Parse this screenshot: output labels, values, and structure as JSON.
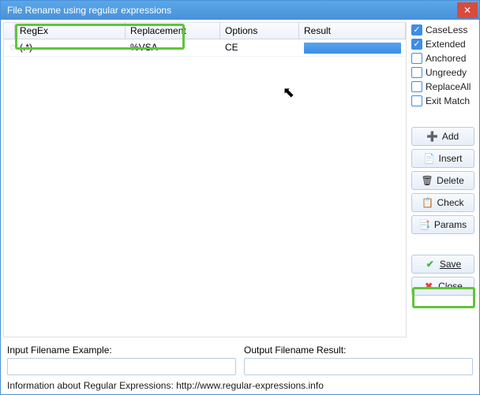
{
  "title": "File Rename using regular expressions",
  "grid": {
    "headers": {
      "regex": "RegEx",
      "replacement": "Replacement",
      "options": "Options",
      "result": "Result"
    },
    "rows": [
      {
        "regex": "(.*)",
        "replacement": "%VSA",
        "options": "CE"
      }
    ]
  },
  "checks": {
    "caseless": {
      "label": "CaseLess",
      "on": true
    },
    "extended": {
      "label": "Extended",
      "on": true
    },
    "anchored": {
      "label": "Anchored",
      "on": false
    },
    "ungreedy": {
      "label": "Ungreedy",
      "on": false
    },
    "replaceall": {
      "label": "ReplaceAll",
      "on": false
    },
    "exitmatch": {
      "label": "Exit Match",
      "on": false
    }
  },
  "buttons": {
    "add": {
      "label": "Add"
    },
    "insert": {
      "label": "Insert"
    },
    "delete": {
      "label": "Delete"
    },
    "check": {
      "label": "Check"
    },
    "params": {
      "label": "Params"
    },
    "save": {
      "label": "Save"
    },
    "close": {
      "label": "Close"
    }
  },
  "bottom": {
    "input_label": "Input Filename Example:",
    "output_label": "Output Filename Result:",
    "info": "Information about Regular Expressions: http://www.regular-expressions.info"
  }
}
